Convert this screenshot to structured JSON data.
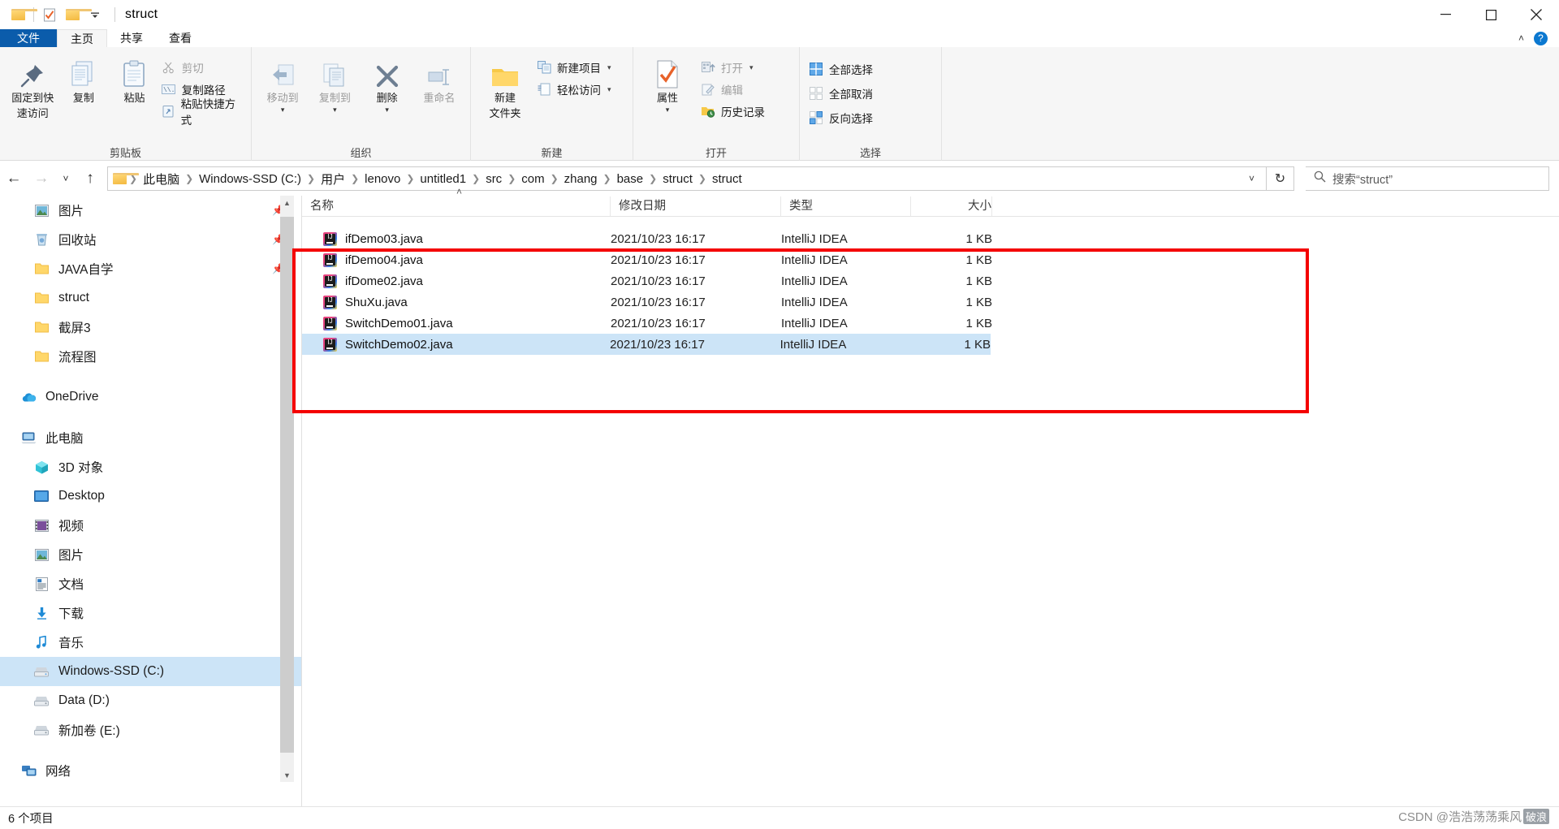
{
  "window": {
    "title": "struct",
    "quick_access": [
      "folder-icon",
      "checkbox-doc-icon",
      "folder-icon",
      "dropdown-caret"
    ],
    "controls": {
      "minimize": "─",
      "maximize": "❐",
      "close": "✕"
    }
  },
  "tabs": [
    {
      "label": "文件",
      "state": "file"
    },
    {
      "label": "主页",
      "state": "active"
    },
    {
      "label": "共享",
      "state": "normal"
    },
    {
      "label": "查看",
      "state": "normal"
    }
  ],
  "ribbon": {
    "collapse_icon": "˄",
    "help_icon": "?",
    "groups": [
      {
        "label": "剪贴板",
        "big": [
          {
            "label_line1": "固定到快",
            "label_line2": "速访问",
            "icon": "pin-icon",
            "dim": false
          },
          {
            "label_line1": "复制",
            "label_line2": "",
            "icon": "copy-icon",
            "dim": false
          },
          {
            "label_line1": "粘贴",
            "label_line2": "",
            "icon": "paste-icon",
            "dim": false
          }
        ],
        "small": [
          {
            "label": "剪切",
            "icon": "scissors-icon",
            "dim": true,
            "caret": false
          },
          {
            "label": "复制路径",
            "icon": "copy-path-icon",
            "dim": false,
            "caret": false
          },
          {
            "label": "粘贴快捷方式",
            "icon": "paste-shortcut-icon",
            "dim": false,
            "caret": false
          }
        ]
      },
      {
        "label": "组织",
        "big": [
          {
            "label_line1": "移动到",
            "label_line2": "",
            "icon": "move-to-icon",
            "dim": true,
            "caret": true
          },
          {
            "label_line1": "复制到",
            "label_line2": "",
            "icon": "copy-to-icon",
            "dim": true,
            "caret": true
          },
          {
            "label_line1": "删除",
            "label_line2": "",
            "icon": "delete-icon",
            "dim": false,
            "caret": true
          },
          {
            "label_line1": "重命名",
            "label_line2": "",
            "icon": "rename-icon",
            "dim": true,
            "caret": false
          }
        ],
        "small": []
      },
      {
        "label": "新建",
        "big": [
          {
            "label_line1": "新建",
            "label_line2": "文件夹",
            "icon": "new-folder-icon",
            "dim": false
          }
        ],
        "small": [
          {
            "label": "新建项目",
            "icon": "new-item-icon",
            "dim": false,
            "caret": true
          },
          {
            "label": "轻松访问",
            "icon": "easy-access-icon",
            "dim": false,
            "caret": true
          }
        ]
      },
      {
        "label": "打开",
        "big": [
          {
            "label_line1": "属性",
            "label_line2": "",
            "icon": "properties-icon",
            "dim": false,
            "caret": true
          }
        ],
        "small": [
          {
            "label": "打开",
            "icon": "open-icon",
            "dim": true,
            "caret": true
          },
          {
            "label": "编辑",
            "icon": "edit-icon",
            "dim": true,
            "caret": false
          },
          {
            "label": "历史记录",
            "icon": "history-icon",
            "dim": false,
            "caret": false
          }
        ]
      },
      {
        "label": "选择",
        "big": [],
        "small": [
          {
            "label": "全部选择",
            "icon": "select-all-icon",
            "dim": false,
            "caret": false
          },
          {
            "label": "全部取消",
            "icon": "select-none-icon",
            "dim": false,
            "caret": false
          },
          {
            "label": "反向选择",
            "icon": "invert-selection-icon",
            "dim": false,
            "caret": false
          }
        ]
      }
    ]
  },
  "addressbar": {
    "back": "←",
    "forward": "→",
    "recent": "˅",
    "up": "↑",
    "breadcrumbs": [
      "此电脑",
      "Windows-SSD (C:)",
      "用户",
      "lenovo",
      "untitled1",
      "src",
      "com",
      "zhang",
      "base",
      "struct",
      "struct"
    ],
    "dropdown": "˅",
    "refresh": "↻",
    "search_placeholder": "搜索“struct”",
    "search_value": ""
  },
  "navpane": {
    "groups": [
      {
        "items": [
          {
            "label": "图片",
            "icon": "pictures-icon",
            "pinned": true,
            "level": 1,
            "selected": false
          },
          {
            "label": "回收站",
            "icon": "recycle-bin-icon",
            "pinned": true,
            "level": 1,
            "selected": false
          },
          {
            "label": "JAVA自学",
            "icon": "folder-icon",
            "pinned": true,
            "level": 1,
            "selected": false
          },
          {
            "label": "struct",
            "icon": "folder-icon",
            "pinned": false,
            "level": 1,
            "selected": false
          },
          {
            "label": "截屏3",
            "icon": "folder-icon",
            "pinned": false,
            "level": 1,
            "selected": false
          },
          {
            "label": "流程图",
            "icon": "folder-icon",
            "pinned": false,
            "level": 1,
            "selected": false
          }
        ]
      },
      {
        "items": [
          {
            "label": "OneDrive",
            "icon": "onedrive-icon",
            "pinned": false,
            "level": 0,
            "selected": false
          }
        ]
      },
      {
        "items": [
          {
            "label": "此电脑",
            "icon": "this-pc-icon",
            "pinned": false,
            "level": 0,
            "selected": false
          },
          {
            "label": "3D 对象",
            "icon": "3d-objects-icon",
            "pinned": false,
            "level": 1,
            "selected": false
          },
          {
            "label": "Desktop",
            "icon": "desktop-icon",
            "pinned": false,
            "level": 1,
            "selected": false
          },
          {
            "label": "视频",
            "icon": "videos-icon",
            "pinned": false,
            "level": 1,
            "selected": false
          },
          {
            "label": "图片",
            "icon": "pictures-icon",
            "pinned": false,
            "level": 1,
            "selected": false
          },
          {
            "label": "文档",
            "icon": "documents-icon",
            "pinned": false,
            "level": 1,
            "selected": false
          },
          {
            "label": "下载",
            "icon": "downloads-icon",
            "pinned": false,
            "level": 1,
            "selected": false
          },
          {
            "label": "音乐",
            "icon": "music-icon",
            "pinned": false,
            "level": 1,
            "selected": false
          },
          {
            "label": "Windows-SSD (C:)",
            "icon": "drive-icon",
            "pinned": false,
            "level": 1,
            "selected": true
          },
          {
            "label": "Data (D:)",
            "icon": "drive-icon",
            "pinned": false,
            "level": 1,
            "selected": false
          },
          {
            "label": "新加卷 (E:)",
            "icon": "drive-icon",
            "pinned": false,
            "level": 1,
            "selected": false
          }
        ]
      },
      {
        "items": [
          {
            "label": "网络",
            "icon": "network-icon",
            "pinned": false,
            "level": 0,
            "selected": false
          }
        ]
      }
    ]
  },
  "filelist": {
    "columns": [
      {
        "label": "名称",
        "key": "name"
      },
      {
        "label": "修改日期",
        "key": "date"
      },
      {
        "label": "类型",
        "key": "type"
      },
      {
        "label": "大小",
        "key": "size"
      }
    ],
    "sort_indicator": "˄",
    "rows": [
      {
        "name": "ifDemo03.java",
        "date": "2021/10/23 16:17",
        "type": "IntelliJ IDEA",
        "size": "1 KB",
        "icon": "intellij-file-icon",
        "selected": false
      },
      {
        "name": "ifDemo04.java",
        "date": "2021/10/23 16:17",
        "type": "IntelliJ IDEA",
        "size": "1 KB",
        "icon": "intellij-file-icon",
        "selected": false
      },
      {
        "name": "ifDome02.java",
        "date": "2021/10/23 16:17",
        "type": "IntelliJ IDEA",
        "size": "1 KB",
        "icon": "intellij-file-icon",
        "selected": false
      },
      {
        "name": "ShuXu.java",
        "date": "2021/10/23 16:17",
        "type": "IntelliJ IDEA",
        "size": "1 KB",
        "icon": "intellij-file-icon",
        "selected": false
      },
      {
        "name": "SwitchDemo01.java",
        "date": "2021/10/23 16:17",
        "type": "IntelliJ IDEA",
        "size": "1 KB",
        "icon": "intellij-file-icon",
        "selected": false
      },
      {
        "name": "SwitchDemo02.java",
        "date": "2021/10/23 16:17",
        "type": "IntelliJ IDEA",
        "size": "1 KB",
        "icon": "intellij-file-icon",
        "selected": true
      }
    ]
  },
  "statusbar": {
    "item_count": "6 个项目"
  },
  "watermark": {
    "prefix": "CSDN @浩浩荡荡乘风",
    "suffix": "破浪"
  },
  "colors": {
    "accent": "#0b5cab",
    "selection": "#cce4f7",
    "annotation": "#f40000",
    "folder": "#fcd06a"
  }
}
